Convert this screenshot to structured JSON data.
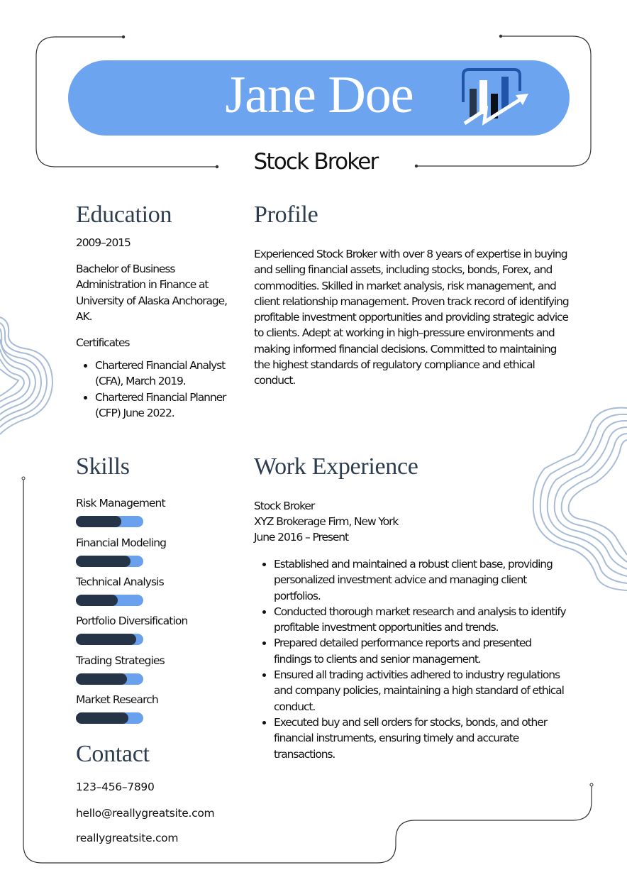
{
  "header": {
    "name": "Jane Doe",
    "title": "Stock Broker",
    "logo_icon": "bar-chart-growth-icon",
    "banner_color": "#6da4f0"
  },
  "education": {
    "heading": "Education",
    "years": "2009–2015",
    "degree": "Bachelor of Business Administration in Finance at University of Alaska Anchorage, AK.",
    "certificates_label": "Certificates",
    "certificates": [
      "Chartered Financial Analyst (CFA), March 2019.",
      "Chartered Financial Planner (CFP) June 2022."
    ]
  },
  "profile": {
    "heading": "Profile",
    "text": "Experienced Stock Broker with over 8 years of expertise in buying and selling financial assets, including stocks, bonds, Forex, and commodities. Skilled in market analysis, risk management, and client relationship management. Proven track record of identifying profitable investment opportunities and providing strategic advice to clients. Adept at working in high–pressure environments and making informed financial decisions. Committed to maintaining the highest standards of regulatory compliance and ethical conduct."
  },
  "skills": {
    "heading": "Skills",
    "items": [
      {
        "label": "Risk Management",
        "level": 0.67
      },
      {
        "label": "Financial Modeling",
        "level": 0.81
      },
      {
        "label": "Technical Analysis",
        "level": 0.62
      },
      {
        "label": "Portfolio Diversification",
        "level": 0.89
      },
      {
        "label": "Trading Strategies",
        "level": 0.76
      },
      {
        "label": "Market Research",
        "level": 0.78
      }
    ],
    "bar_fill_color": "#263447",
    "bar_track_color": "#6aa1ee"
  },
  "work": {
    "heading": "Work Experience",
    "job_title": "Stock Broker",
    "company": "XYZ Brokerage Firm, New York",
    "dates": "June 2016 – Present",
    "bullets": [
      "Established and maintained a robust client base, providing personalized investment advice and managing client portfolios.",
      "Conducted thorough market research and analysis to identify profitable investment opportunities and trends.",
      "Prepared detailed performance reports and presented findings to clients and senior management.",
      "Ensured all trading activities adhered to industry regulations and company policies, maintaining a high standard of ethical conduct.",
      "Executed buy and sell orders for stocks, bonds, and other financial instruments, ensuring timely and accurate transactions."
    ]
  },
  "contact": {
    "heading": "Contact",
    "phone": "123–456–7890",
    "email": "hello@reallygreatsite.com",
    "website": "reallygreatsite.com"
  }
}
